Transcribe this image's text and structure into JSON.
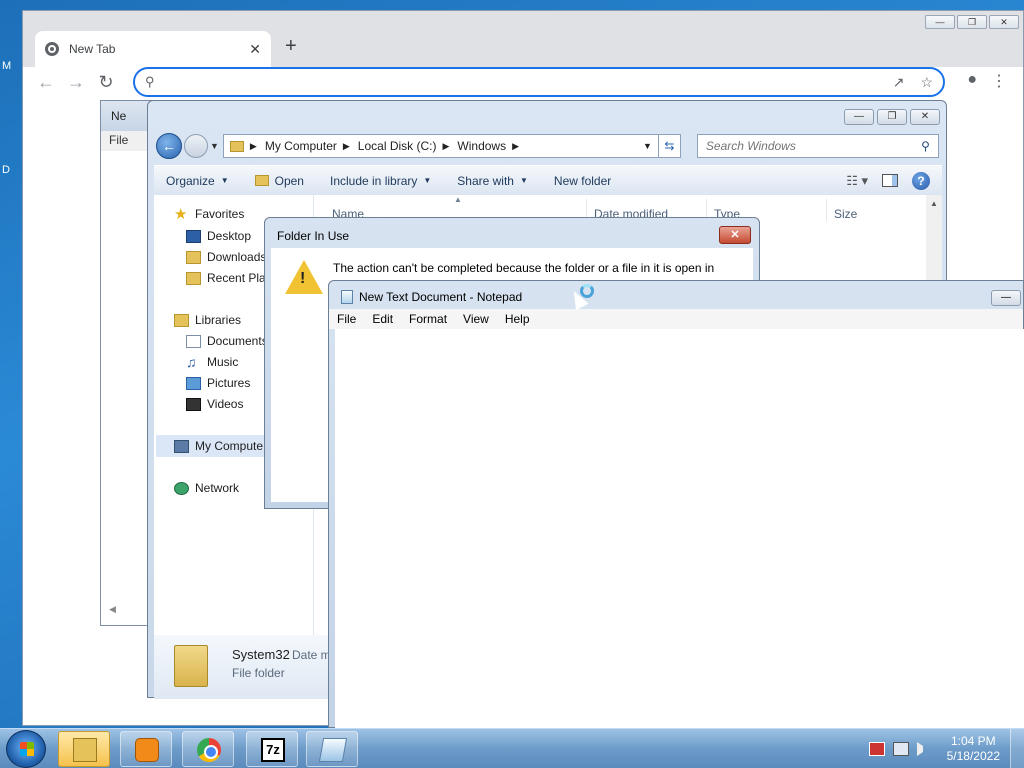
{
  "desktop": {
    "frag_left_1": "M",
    "frag_left_2": "D"
  },
  "chrome": {
    "tab_title": "New Tab",
    "tab_close": "✕",
    "new_tab": "+",
    "window_controls": [
      "—",
      "❐",
      "✕"
    ],
    "omnibox_value": "",
    "nav": {
      "back": "←",
      "forward": "→",
      "reload": "↻"
    }
  },
  "explorer_back": {
    "title": "Ne",
    "menu_file": "File"
  },
  "explorer": {
    "window_controls": [
      "—",
      "❐",
      "✕"
    ],
    "breadcrumb": [
      "My Computer",
      "Local Disk (C:)",
      "Windows"
    ],
    "search_placeholder": "Search Windows",
    "commands": {
      "organize": "Organize",
      "open": "Open",
      "include_in_library": "Include in library",
      "share_with": "Share with",
      "new_folder": "New folder"
    },
    "nav_pane": {
      "favorites": "Favorites",
      "desktop": "Desktop",
      "downloads": "Downloads",
      "recent_places": "Recent Plac",
      "libraries": "Libraries",
      "documents": "Documents",
      "music": "Music",
      "pictures": "Pictures",
      "videos": "Videos",
      "my_computer": "My Compute",
      "network": "Network"
    },
    "columns": {
      "name": "Name",
      "date_modified": "Date modified",
      "type": "Type",
      "size": "Size"
    },
    "details": {
      "name": "System32",
      "date_label": "Date m",
      "type": "File folder"
    }
  },
  "dialog": {
    "title": "Folder In Use",
    "close": "✕",
    "message": "The action can't be completed because the folder or a file in it is open in"
  },
  "notepad": {
    "title": "New Text Document - Notepad",
    "minimize": "—",
    "menu": [
      "File",
      "Edit",
      "Format",
      "View",
      "Help"
    ],
    "content": ""
  },
  "taskbar": {
    "seven_zip_label": "7z",
    "time": "1:04 PM",
    "date": "5/18/2022"
  }
}
